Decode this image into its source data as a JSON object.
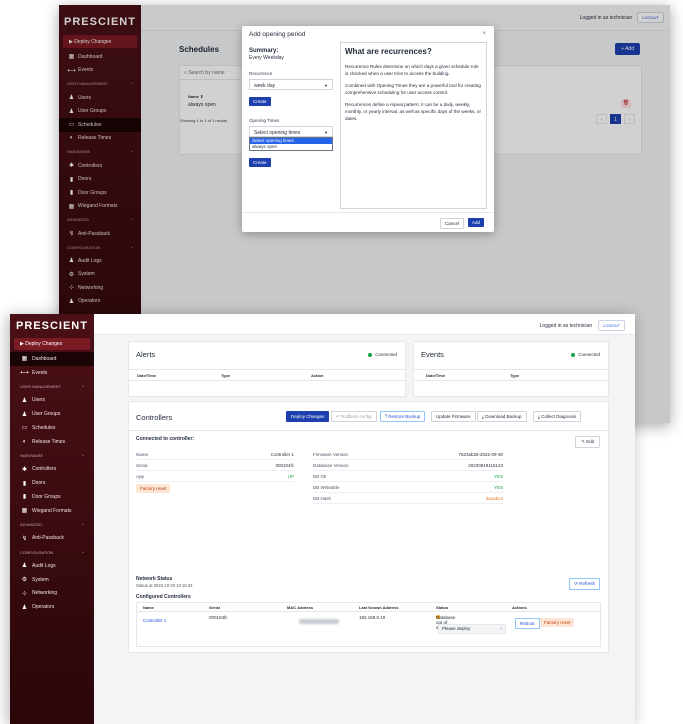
{
  "brand": "PRESCIENT",
  "colors": {
    "sidebar": "#3a0b10",
    "accent": "#1e40af",
    "success": "#16a34a",
    "warning": "#f97316"
  },
  "deploy_label": "Deploy Changes",
  "header": {
    "logged_in": "Logged in as technician",
    "logout": "LOGOUT"
  },
  "sidebar_back": [
    {
      "type": "item",
      "icon": "dashboard-icon",
      "glyph": "▦",
      "label": "Dashboard"
    },
    {
      "type": "item",
      "icon": "events-icon",
      "glyph": "⟷",
      "label": "Events"
    },
    {
      "type": "section",
      "label": "USER MANAGEMENT",
      "glyph": "^"
    },
    {
      "type": "item",
      "icon": "user-icon",
      "glyph": "♟",
      "label": "Users"
    },
    {
      "type": "item",
      "icon": "user-group-icon",
      "glyph": "♟",
      "label": "User Groups"
    },
    {
      "type": "item",
      "icon": "calendar-icon",
      "glyph": "▭",
      "label": "Schedules",
      "active": true
    },
    {
      "type": "item",
      "icon": "release-time-icon",
      "glyph": "◐",
      "label": "Release Times"
    },
    {
      "type": "section",
      "label": "HARDWARE",
      "glyph": "^"
    },
    {
      "type": "item",
      "icon": "controller-icon",
      "glyph": "✱",
      "label": "Controllers"
    },
    {
      "type": "item",
      "icon": "door-icon",
      "glyph": "▮",
      "label": "Doors"
    },
    {
      "type": "item",
      "icon": "door-group-icon",
      "glyph": "▮",
      "label": "Door Groups"
    },
    {
      "type": "item",
      "icon": "wiegand-icon",
      "glyph": "▦",
      "label": "Wiegand Formats"
    },
    {
      "type": "section",
      "label": "ADVANCED",
      "glyph": "^"
    },
    {
      "type": "item",
      "icon": "anti-passback-icon",
      "glyph": "↯",
      "label": "Anti-Passback"
    },
    {
      "type": "section",
      "label": "CONFIGURATION",
      "glyph": "^"
    },
    {
      "type": "item",
      "icon": "audit-logs-icon",
      "glyph": "♟",
      "label": "Audit Logs"
    },
    {
      "type": "item",
      "icon": "system-icon",
      "glyph": "⚙",
      "label": "System"
    },
    {
      "type": "item",
      "icon": "networking-icon",
      "glyph": "⊹",
      "label": "Networking"
    },
    {
      "type": "item",
      "icon": "operators-icon",
      "glyph": "♟",
      "label": "Operators"
    }
  ],
  "sidebar_front": [
    {
      "type": "item",
      "icon": "dashboard-icon",
      "glyph": "▦",
      "label": "Dashboard",
      "active": true
    },
    {
      "type": "item",
      "icon": "events-icon",
      "glyph": "⟷",
      "label": "Events"
    },
    {
      "type": "section",
      "label": "USER MANAGEMENT",
      "glyph": "^"
    },
    {
      "type": "item",
      "icon": "user-icon",
      "glyph": "♟",
      "label": "Users"
    },
    {
      "type": "item",
      "icon": "user-group-icon",
      "glyph": "♟",
      "label": "User Groups"
    },
    {
      "type": "item",
      "icon": "calendar-icon",
      "glyph": "▭",
      "label": "Schedules"
    },
    {
      "type": "item",
      "icon": "release-time-icon",
      "glyph": "◐",
      "label": "Release Times"
    },
    {
      "type": "section",
      "label": "HARDWARE",
      "glyph": "^"
    },
    {
      "type": "item",
      "icon": "controller-icon",
      "glyph": "✱",
      "label": "Controllers"
    },
    {
      "type": "item",
      "icon": "door-icon",
      "glyph": "▮",
      "label": "Doors"
    },
    {
      "type": "item",
      "icon": "door-group-icon",
      "glyph": "▮",
      "label": "Door Groups"
    },
    {
      "type": "item",
      "icon": "wiegand-icon",
      "glyph": "▦",
      "label": "Wiegand Formats"
    },
    {
      "type": "section",
      "label": "ADVANCED",
      "glyph": "^"
    },
    {
      "type": "item",
      "icon": "anti-passback-icon",
      "glyph": "↯",
      "label": "Anti-Passback"
    },
    {
      "type": "section",
      "label": "CONFIGURATION",
      "glyph": "^"
    },
    {
      "type": "item",
      "icon": "audit-logs-icon",
      "glyph": "♟",
      "label": "Audit Logs"
    },
    {
      "type": "item",
      "icon": "system-icon",
      "glyph": "⚙",
      "label": "System"
    },
    {
      "type": "item",
      "icon": "networking-icon",
      "glyph": "⊹",
      "label": "Networking"
    },
    {
      "type": "item",
      "icon": "operators-icon",
      "glyph": "♟",
      "label": "Operators"
    }
  ],
  "schedules": {
    "title": "Schedules",
    "add": "+ Add",
    "search_placeholder": "Search by name",
    "col_name": "Name ⇕",
    "row_name": "always open",
    "showing": "Showing 1 to 1 of 1 results",
    "pages": [
      "‹",
      "1",
      "›"
    ]
  },
  "modal": {
    "title": "Add opening period",
    "close": "×",
    "summary_label": "Summary:",
    "summary_value": "Every Weekday",
    "recurrence_label": "Recurrence",
    "recurrence_value": "week day",
    "create": "Create",
    "opening_label": "Opening Times",
    "opening_value": "Select opening times",
    "options": [
      "Select opening times",
      "always open"
    ],
    "help_title": "What are recurrences?",
    "help_p1": "Recurrence Rules determine on which days a given schedule rule is checked when a user tries to access the building.",
    "help_p2": "Combined with Opening Times they are a powerful tool for creating comprehensive scheduling for user access control.",
    "help_p3": "Recurrences define a repeat pattern; it can be a daily, weekly, monthly, or yearly interval, as well as specific days of the weeks, or dates.",
    "cancel": "Cancel",
    "add": "Add"
  },
  "alerts": {
    "title": "Alerts",
    "status": "Connected",
    "cols": [
      "Date/Time",
      "Type",
      "Action"
    ]
  },
  "events": {
    "title": "Events",
    "status": "Connected",
    "cols": [
      "Date/Time",
      "Type"
    ]
  },
  "controllers": {
    "title": "Controllers",
    "buttons": {
      "deploy": "Deploy Changes",
      "rollback": "↶ Rollback config",
      "restore": "⤒ Restore Backup",
      "update": "Update Firmware",
      "download": "⤓ Download Backup",
      "diagnosis": "⤓ Collect Diagnosis"
    },
    "connected_title": "Connected to controller:",
    "edit": "✎ Edit",
    "left": [
      {
        "k": "Name",
        "v": "Controller 1",
        "c": ""
      },
      {
        "k": "Serial",
        "v": "000104fc",
        "c": ""
      },
      {
        "k": "App",
        "v": "UP",
        "c": "green"
      }
    ],
    "right": [
      {
        "k": "Firmware Version",
        "v": "7523ab25-2022-09-30",
        "c": ""
      },
      {
        "k": "Database Version",
        "v": "20220919115123",
        "c": ""
      },
      {
        "k": "DB Ok",
        "v": "YES",
        "c": "green"
      },
      {
        "k": "DB Writeable",
        "v": "YES",
        "c": "green"
      },
      {
        "k": "DB Hash",
        "v": "3a1ebc4",
        "c": "orange"
      }
    ],
    "factory_reset": "Factory reset",
    "network_title": "Network Status",
    "network_sub": "Status at 2023-10-03 10:15:34",
    "refresh": "⟳ Refresh",
    "configured_title": "Configured Controllers",
    "table_cols": [
      "Name",
      "Serial",
      "MAC Address",
      "Last Known Address",
      "Status",
      "Actions"
    ],
    "row": {
      "name": "Controller 1",
      "serial": "000104fc",
      "ip": "192.168.0.19",
      "status": "Database out of sync",
      "action_value": "Please deploy",
      "reboot": "Reboot",
      "factory": "Factory reset"
    }
  }
}
